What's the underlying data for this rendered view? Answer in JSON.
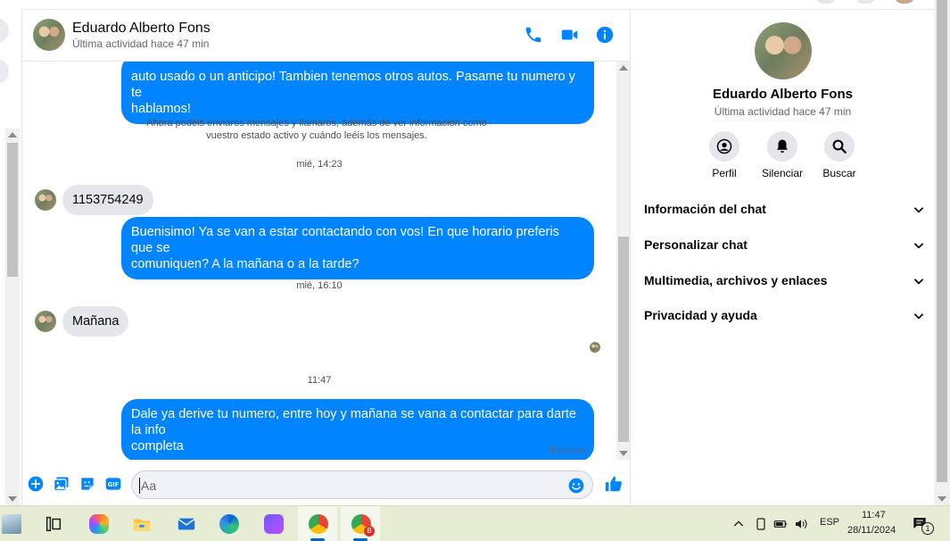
{
  "contact": {
    "name": "Eduardo Alberto Fons",
    "status": "Última actividad hace 47 min"
  },
  "messages": {
    "out1_line1": "auto usado o un anticipo! Tambien tenemos otros autos. Pasame tu numero y te",
    "out1_line2": "hablamos!",
    "system_note_line1": "Ahora podéis enviaros mensajes y llamaros, además de ver información como",
    "system_note_line2": "vuestro estado activo y cuándo leéis los mensajes.",
    "time1": "mié, 14:23",
    "in1": "1153754249",
    "out2_line1": "Buenisimo! Ya se van a estar contactando con vos! En que horario preferis que se",
    "out2_line2": "comuniquen? A la mañana o a la tarde?",
    "time2": "mié, 16:10",
    "in2": "Mañana",
    "time3": "11:47",
    "out3_line1": "Dale ya derive tu numero, entre hoy y mañana se vana a contactar para darte la info",
    "out3_line2": "completa",
    "sent_status": "Enviado"
  },
  "composer": {
    "placeholder": "Aa"
  },
  "info_panel": {
    "actions": [
      {
        "label": "Perfil",
        "icon": "profile-icon"
      },
      {
        "label": "Silenciar",
        "icon": "bell-icon"
      },
      {
        "label": "Buscar",
        "icon": "search-icon"
      }
    ],
    "sections": [
      "Información del chat",
      "Personalizar chat",
      "Multimedia, archivos y enlaces",
      "Privacidad y ayuda"
    ]
  },
  "taskbar": {
    "language": "ESP",
    "time": "11:47",
    "date": "28/11/2024",
    "notification_count": "1",
    "chrome_badge": "B"
  },
  "colors": {
    "accent": "#0084ff",
    "incoming_bubble": "#e4e6eb",
    "taskbar": "#e7edd5"
  }
}
